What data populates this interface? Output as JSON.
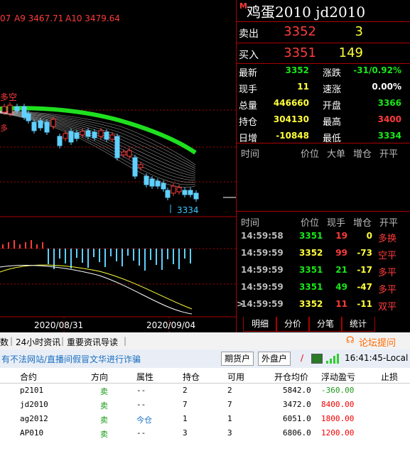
{
  "chart": {
    "top_text_a": "07",
    "top_text_ma9": "A9 3467.71",
    "top_text_ma10": "A10 3479.64",
    "signal_label": "多空",
    "price_low_label": "3334",
    "dates": [
      "2020/08/31",
      "2020/09/04"
    ]
  },
  "quote": {
    "marker": "M",
    "name": "鸡蛋2010   jd2010",
    "ask_label": "卖出",
    "ask_price": "3352",
    "ask_vol": "3",
    "bid_label": "买入",
    "bid_price": "3351",
    "bid_vol": "149",
    "fields": [
      {
        "label": "最新",
        "value": "3352"
      },
      {
        "label": "涨跌",
        "value": "-31/0.92%"
      },
      {
        "label": "现手",
        "value": "11"
      },
      {
        "label": "速涨",
        "value": "0.00%"
      },
      {
        "label": "总量",
        "value": "446660"
      },
      {
        "label": "开盘",
        "value": "3366"
      },
      {
        "label": "持仓",
        "value": "304130"
      },
      {
        "label": "最高",
        "value": "3400"
      },
      {
        "label": "日增",
        "value": "-10848"
      },
      {
        "label": "最低",
        "value": "3334"
      }
    ]
  },
  "big_orders": {
    "headers": [
      "时间",
      "价位",
      "大单",
      "增仓",
      "开平"
    ]
  },
  "ticks": {
    "headers": [
      "时间",
      "价位",
      "现手",
      "增仓",
      "开平"
    ],
    "rows": [
      {
        "time": "14:59:58",
        "price": "3351",
        "vol": "19",
        "oi": "0",
        "type": "多换"
      },
      {
        "time": "14:59:59",
        "price": "3352",
        "vol": "99",
        "oi": "-73",
        "type": "空平"
      },
      {
        "time": "14:59:59",
        "price": "3351",
        "vol": "21",
        "oi": "-17",
        "type": "多平"
      },
      {
        "time": "14:59:59",
        "price": "3351",
        "vol": "49",
        "oi": "-47",
        "type": "多平"
      },
      {
        "time": "14:59:59",
        "price": "3352",
        "vol": "11",
        "oi": "-11",
        "type": "双平"
      }
    ],
    "cursor": ">"
  },
  "tabs": [
    "明细",
    "分价",
    "分笔",
    "统计"
  ],
  "forum_link": "论坛提问",
  "info_bar": {
    "items": [
      "数",
      "24小时资讯",
      "重要资讯导读"
    ]
  },
  "status_bar": {
    "notice": "有不法网站/直播间假冒文华进行诈骗",
    "btn_futures": "期货户",
    "btn_foreign": "外盘户",
    "slash": "/",
    "clock": "16:41:45-Local"
  },
  "positions": {
    "headers": [
      "合约",
      "方向",
      "属性",
      "持仓",
      "可用",
      "开仓均价",
      "浮动盈亏",
      "止损"
    ],
    "rows": [
      {
        "contract": "p2101",
        "dir": "卖",
        "attr": "--",
        "pos": "2",
        "avail": "2",
        "avg": "5842.0",
        "pnl": "-360.00",
        "stop": ""
      },
      {
        "contract": "jd2010",
        "dir": "卖",
        "attr": "--",
        "pos": "7",
        "avail": "7",
        "avg": "3472.0",
        "pnl": "8400.00",
        "stop": ""
      },
      {
        "contract": "ag2012",
        "dir": "卖",
        "attr": "今仓",
        "pos": "1",
        "avail": "1",
        "avg": "6051.0",
        "pnl": "1800.00",
        "stop": ""
      },
      {
        "contract": "AP010",
        "dir": "卖",
        "attr": "--",
        "pos": "3",
        "avail": "3",
        "avg": "6806.0",
        "pnl": "1200.00",
        "stop": ""
      }
    ]
  },
  "colors": {
    "up": "#ff3b3b",
    "down": "#19e619",
    "flat": "#ffff3c",
    "accent": "#a00000"
  }
}
